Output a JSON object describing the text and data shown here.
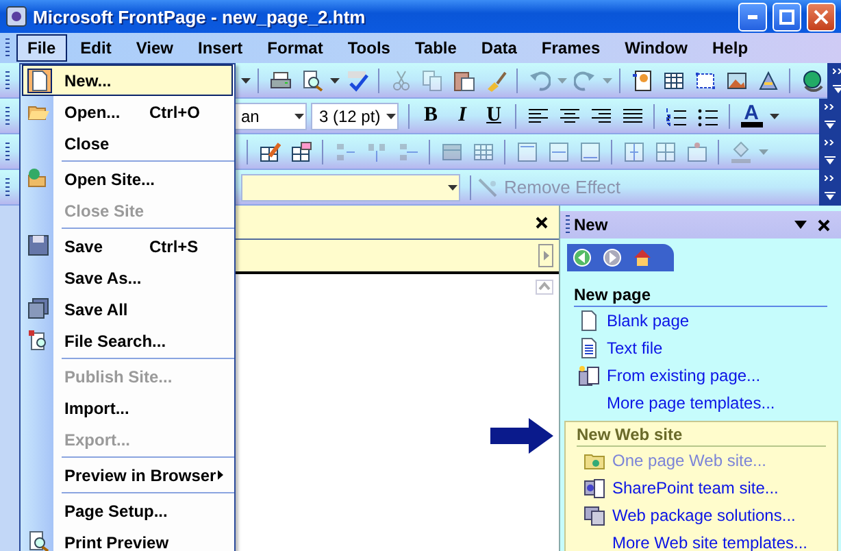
{
  "window": {
    "title": "Microsoft FrontPage - new_page_2.htm"
  },
  "menubar": [
    {
      "label": "File",
      "selected": true
    },
    {
      "label": "Edit",
      "selected": false
    },
    {
      "label": "View",
      "selected": false
    },
    {
      "label": "Insert",
      "selected": false
    },
    {
      "label": "Format",
      "selected": false
    },
    {
      "label": "Tools",
      "selected": false
    },
    {
      "label": "Table",
      "selected": false
    },
    {
      "label": "Data",
      "selected": false
    },
    {
      "label": "Frames",
      "selected": false
    },
    {
      "label": "Window",
      "selected": false
    },
    {
      "label": "Help",
      "selected": false
    }
  ],
  "file_menu": [
    {
      "kind": "item",
      "label": "New...",
      "selected": true,
      "disabled": false
    },
    {
      "kind": "item",
      "label": "Open...",
      "shortcut": "Ctrl+O",
      "selected": false,
      "disabled": false
    },
    {
      "kind": "item",
      "label": "Close",
      "selected": false,
      "disabled": false
    },
    {
      "kind": "separator"
    },
    {
      "kind": "item",
      "label": "Open Site...",
      "selected": false,
      "disabled": false
    },
    {
      "kind": "item",
      "label": "Close Site",
      "selected": false,
      "disabled": true
    },
    {
      "kind": "separator"
    },
    {
      "kind": "item",
      "label": "Save",
      "shortcut": "Ctrl+S",
      "selected": false,
      "disabled": false
    },
    {
      "kind": "item",
      "label": "Save As...",
      "selected": false,
      "disabled": false
    },
    {
      "kind": "item",
      "label": "Save All",
      "selected": false,
      "disabled": false
    },
    {
      "kind": "item",
      "label": "File Search...",
      "selected": false,
      "disabled": false
    },
    {
      "kind": "separator"
    },
    {
      "kind": "item",
      "label": "Publish Site...",
      "selected": false,
      "disabled": true
    },
    {
      "kind": "item",
      "label": "Import...",
      "selected": false,
      "disabled": false
    },
    {
      "kind": "item",
      "label": "Export...",
      "selected": false,
      "disabled": true
    },
    {
      "kind": "separator"
    },
    {
      "kind": "submenu",
      "label": "Preview in Browser",
      "selected": false,
      "disabled": false
    },
    {
      "kind": "separator"
    },
    {
      "kind": "item",
      "label": "Page Setup...",
      "selected": false,
      "disabled": false
    },
    {
      "kind": "item",
      "label": "Print Preview",
      "selected": false,
      "disabled": false
    }
  ],
  "toolbars": [
    {
      "items": [
        {
          "kind": "caret",
          "disabled": false
        },
        {
          "kind": "sep"
        },
        {
          "kind": "icon",
          "disabled": false
        },
        {
          "kind": "icon",
          "disabled": false
        },
        {
          "kind": "caret",
          "disabled": false
        },
        {
          "kind": "icon",
          "disabled": false
        },
        {
          "kind": "sep"
        },
        {
          "kind": "icon",
          "disabled": true
        },
        {
          "kind": "icon",
          "disabled": true
        },
        {
          "kind": "icon",
          "disabled": false
        },
        {
          "kind": "icon",
          "disabled": false
        },
        {
          "kind": "sep"
        },
        {
          "kind": "icon",
          "disabled": true
        },
        {
          "kind": "caret",
          "disabled": true
        },
        {
          "kind": "icon",
          "disabled": true
        },
        {
          "kind": "caret",
          "disabled": true
        },
        {
          "kind": "sep"
        },
        {
          "kind": "icon",
          "disabled": false
        },
        {
          "kind": "icon",
          "disabled": false
        },
        {
          "kind": "icon",
          "disabled": false
        },
        {
          "kind": "icon",
          "disabled": false
        },
        {
          "kind": "icon",
          "disabled": false
        },
        {
          "kind": "sep"
        },
        {
          "kind": "icon",
          "disabled": false
        }
      ]
    },
    {
      "items": [
        {
          "kind": "combo",
          "value": "an"
        },
        {
          "kind": "combo",
          "value": "3 (12 pt)"
        },
        {
          "kind": "sep"
        },
        {
          "kind": "text",
          "label": "B"
        },
        {
          "kind": "text",
          "label": "I"
        },
        {
          "kind": "text",
          "label": "U"
        },
        {
          "kind": "sep"
        },
        {
          "kind": "icon",
          "disabled": false
        },
        {
          "kind": "icon",
          "disabled": false
        },
        {
          "kind": "icon",
          "disabled": false
        },
        {
          "kind": "icon",
          "disabled": false
        },
        {
          "kind": "sep"
        },
        {
          "kind": "icon",
          "disabled": false
        },
        {
          "kind": "icon",
          "disabled": false
        },
        {
          "kind": "sep"
        },
        {
          "kind": "text",
          "label": "A",
          "color": "#000000"
        },
        {
          "kind": "caret",
          "disabled": false
        }
      ]
    },
    {
      "items": [
        {
          "kind": "sep"
        },
        {
          "kind": "icon",
          "disabled": false
        },
        {
          "kind": "icon",
          "disabled": false
        },
        {
          "kind": "sep"
        },
        {
          "kind": "icon",
          "disabled": true
        },
        {
          "kind": "icon",
          "disabled": true
        },
        {
          "kind": "icon",
          "disabled": true
        },
        {
          "kind": "sep"
        },
        {
          "kind": "icon",
          "disabled": true
        },
        {
          "kind": "icon",
          "disabled": true
        },
        {
          "kind": "sep"
        },
        {
          "kind": "icon",
          "disabled": true
        },
        {
          "kind": "icon",
          "disabled": true
        },
        {
          "kind": "icon",
          "disabled": true
        },
        {
          "kind": "sep"
        },
        {
          "kind": "icon",
          "disabled": true
        },
        {
          "kind": "icon",
          "disabled": true
        },
        {
          "kind": "icon",
          "disabled": true
        },
        {
          "kind": "sep"
        },
        {
          "kind": "icon",
          "disabled": true
        },
        {
          "kind": "caret",
          "disabled": true
        }
      ]
    },
    {
      "items": [
        {
          "kind": "combo",
          "value": ""
        },
        {
          "kind": "sep"
        },
        {
          "kind": "button",
          "label": "Remove Effect",
          "disabled": true
        }
      ]
    }
  ],
  "task_pane": {
    "title": "New",
    "sections": [
      {
        "heading": "New page",
        "highlighted": false,
        "items": [
          {
            "label": "Blank page",
            "disabled": false
          },
          {
            "label": "Text file",
            "disabled": false
          },
          {
            "label": "From existing page...",
            "disabled": false
          },
          {
            "label": "More page templates...",
            "disabled": false
          }
        ]
      },
      {
        "heading": "New Web site",
        "highlighted": true,
        "items": [
          {
            "label": "One page Web site...",
            "disabled": true
          },
          {
            "label": "SharePoint team site...",
            "disabled": false
          },
          {
            "label": "Web package solutions...",
            "disabled": false
          },
          {
            "label": "More Web site templates...",
            "disabled": false
          }
        ]
      }
    ]
  }
}
